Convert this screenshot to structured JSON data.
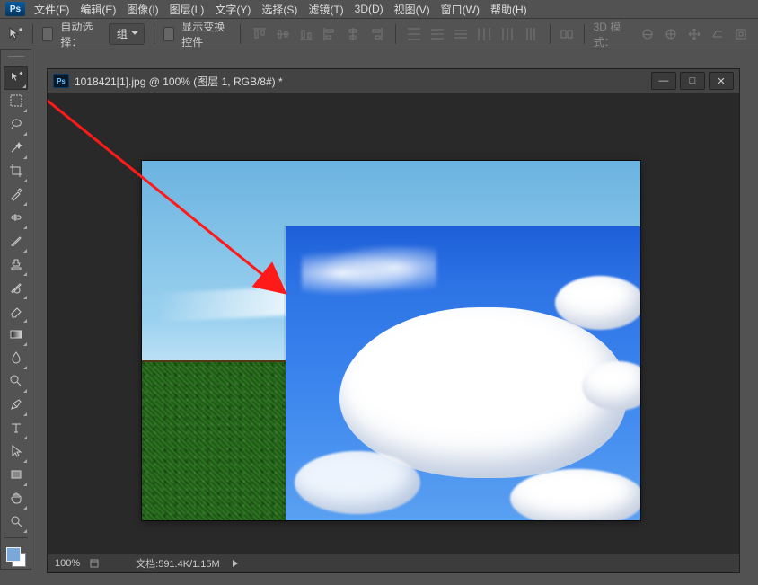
{
  "app": {
    "logo": "Ps"
  },
  "menu": [
    "文件(F)",
    "编辑(E)",
    "图像(I)",
    "图层(L)",
    "文字(Y)",
    "选择(S)",
    "滤镜(T)",
    "3D(D)",
    "视图(V)",
    "窗口(W)",
    "帮助(H)"
  ],
  "options": {
    "auto_select_label": "自动选择：",
    "auto_select_value": "组",
    "show_transform_label": "显示变换控件",
    "mode_label": "3D 模式："
  },
  "tools": [
    {
      "n": "move-tool",
      "selected": true,
      "icon": "move"
    },
    {
      "n": "marquee-tool",
      "icon": "marq"
    },
    {
      "n": "lasso-tool",
      "icon": "lasso"
    },
    {
      "n": "magic-wand-tool",
      "icon": "wand"
    },
    {
      "n": "crop-tool",
      "icon": "crop"
    },
    {
      "n": "eyedropper-tool",
      "icon": "eye"
    },
    {
      "n": "healing-brush-tool",
      "icon": "heal"
    },
    {
      "n": "brush-tool",
      "icon": "brush"
    },
    {
      "n": "clone-stamp-tool",
      "icon": "stamp"
    },
    {
      "n": "history-brush-tool",
      "icon": "hbrush"
    },
    {
      "n": "eraser-tool",
      "icon": "eraser"
    },
    {
      "n": "gradient-tool",
      "icon": "grad"
    },
    {
      "n": "blur-tool",
      "icon": "blur"
    },
    {
      "n": "dodge-tool",
      "icon": "dodge"
    },
    {
      "n": "pen-tool",
      "icon": "pen"
    },
    {
      "n": "type-tool",
      "icon": "type"
    },
    {
      "n": "path-selection-tool",
      "icon": "path"
    },
    {
      "n": "rectangle-tool",
      "icon": "rect"
    },
    {
      "n": "hand-tool",
      "icon": "hand"
    },
    {
      "n": "zoom-tool",
      "icon": "zoom"
    }
  ],
  "doc": {
    "tab_icon": "Ps",
    "title": "1018421[1].jpg @ 100% (图层 1, RGB/8#) *"
  },
  "status": {
    "zoom": "100%",
    "doc_info": "文档:591.4K/1.15M"
  }
}
